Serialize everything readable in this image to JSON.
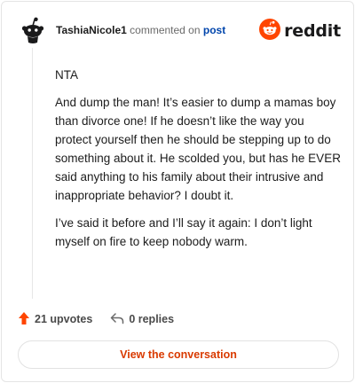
{
  "header": {
    "author": "TashiaNicole1",
    "action_text": "commented on",
    "post_link": "post",
    "brand_name": "reddit"
  },
  "comment": {
    "paragraphs": [
      "NTA",
      "And dump the man! It’s easier to dump a mamas boy than divorce one! If he doesn’t like the way you protect yourself then he should be stepping up to do something about it. He scolded you, but has he EVER said anything to his family about their intrusive and inappropriate behavior? I doubt it.",
      "I’ve said it before and I’ll say it again: I don’t light myself on fire to keep nobody warm."
    ]
  },
  "actions": {
    "upvotes": "21 upvotes",
    "replies": "0 replies"
  },
  "cta": {
    "label": "View the conversation"
  },
  "icons": {
    "avatar": "snoo-avatar-icon",
    "brand": "reddit-logo-icon",
    "upvote": "upvote-arrow-icon",
    "reply": "reply-arrow-icon"
  },
  "colors": {
    "brand_orange": "#ff4500",
    "upvote": "#ff4500",
    "cta_text": "#d93a00",
    "link": "#0045ac"
  }
}
